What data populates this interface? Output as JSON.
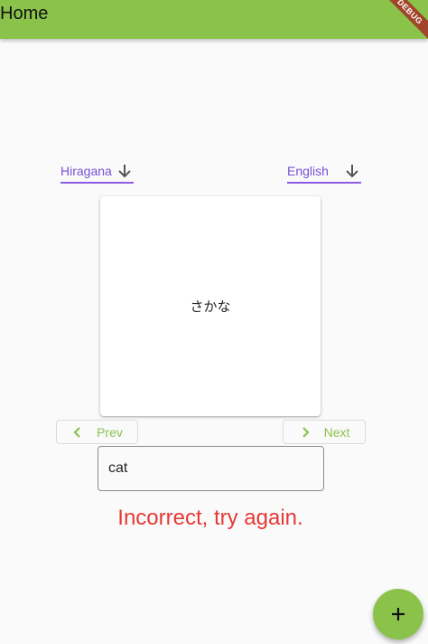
{
  "appbar": {
    "title": "Home",
    "color": "#8bc34a",
    "debug_banner": "DEBUG"
  },
  "source_dropdown": {
    "selected": "Hiragana",
    "icon": "arrow-down-icon"
  },
  "target_dropdown": {
    "selected": "English",
    "icon": "arrow-down-icon"
  },
  "flashcard": {
    "word": "さかな"
  },
  "navigation": {
    "prev_label": "Prev",
    "prev_icon": "chevron-left-icon",
    "next_label": "Next",
    "next_icon": "chevron-right-icon"
  },
  "answer": {
    "value": "cat"
  },
  "feedback": {
    "message": "Incorrect, try again.",
    "color": "#e53935"
  },
  "fab": {
    "icon": "plus-icon"
  },
  "colors": {
    "accent": "#8bc34a",
    "dropdown_underline": "#8c5ce6"
  }
}
